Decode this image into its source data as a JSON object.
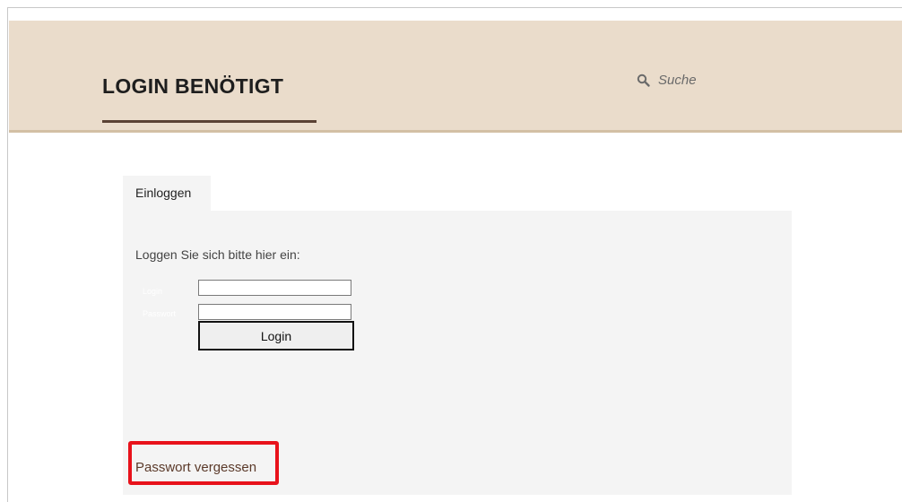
{
  "header": {
    "title": "LOGIN BENÖTIGT",
    "search_placeholder": "Suche",
    "search_icon": "magnifier-icon",
    "background_color": "#eadccb",
    "accent_color": "#5a4234"
  },
  "login_form": {
    "tab_label": "Einloggen",
    "intro_text": "Loggen Sie sich bitte hier ein:",
    "login_label": "Login",
    "login_value": "",
    "password_label": "Passwort",
    "password_value": "",
    "submit_label": "Login",
    "forgot_password_label": "Passwort vergessen"
  },
  "highlight": {
    "color": "#e8121b",
    "target": "forgot-password-link"
  }
}
